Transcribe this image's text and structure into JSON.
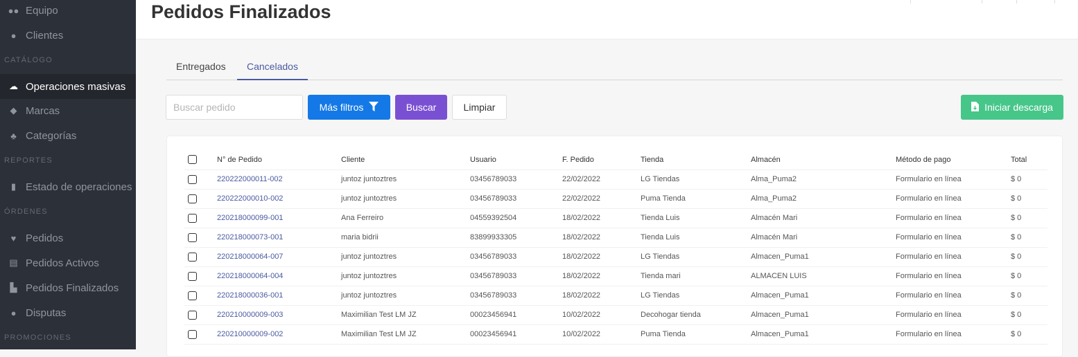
{
  "sidebar": {
    "items": [
      {
        "label": "Equipo",
        "icon": "users-icon"
      },
      {
        "label": "Clientes",
        "icon": "user-icon"
      },
      {
        "label": "Operaciones masivas",
        "icon": "cloud-upload-icon"
      },
      {
        "label": "Marcas",
        "icon": "tags-icon"
      },
      {
        "label": "Categorías",
        "icon": "sitemap-icon"
      },
      {
        "label": "Estado de operaciones",
        "icon": "file-upload-icon"
      },
      {
        "label": "Pedidos",
        "icon": "parachute-box-icon"
      },
      {
        "label": "Pedidos Activos",
        "icon": "file-alt-icon"
      },
      {
        "label": "Pedidos Finalizados",
        "icon": "pallet-icon"
      },
      {
        "label": "Disputas",
        "icon": "comments-icon"
      }
    ],
    "sections": [
      "CATÁLOGO",
      "REPORTES",
      "ÓRDENES",
      "PROMOCIONES"
    ]
  },
  "header": {
    "title": "Pedidos Finalizados"
  },
  "tabs": [
    "Entregados",
    "Cancelados"
  ],
  "toolbar": {
    "search_placeholder": "Buscar pedido",
    "more_filters": "Más filtros",
    "search": "Buscar",
    "clear": "Limpiar",
    "download": "Iniciar descarga"
  },
  "table": {
    "columns": [
      "N° de Pedido",
      "Cliente",
      "Usuario",
      "F. Pedido",
      "Tienda",
      "Almacén",
      "Método de pago",
      "Total"
    ],
    "rows": [
      [
        "220222000011-002",
        "juntoz juntoztres",
        "03456789033",
        "22/02/2022",
        "LG Tiendas",
        "Alma_Puma2",
        "Formulario en línea",
        "$ 0"
      ],
      [
        "220222000010-002",
        "juntoz juntoztres",
        "03456789033",
        "22/02/2022",
        "Puma Tienda",
        "Alma_Puma2",
        "Formulario en línea",
        "$ 0"
      ],
      [
        "220218000099-001",
        "Ana Ferreiro",
        "04559392504",
        "18/02/2022",
        "Tienda Luis",
        "Almacén Mari",
        "Formulario en línea",
        "$ 0"
      ],
      [
        "220218000073-001",
        "maria bidrii",
        "83899933305",
        "18/02/2022",
        "Tienda Luis",
        "Almacén Mari",
        "Formulario en línea",
        "$ 0"
      ],
      [
        "220218000064-007",
        "juntoz juntoztres",
        "03456789033",
        "18/02/2022",
        "LG Tiendas",
        "Almacen_Puma1",
        "Formulario en línea",
        "$ 0"
      ],
      [
        "220218000064-004",
        "juntoz juntoztres",
        "03456789033",
        "18/02/2022",
        "Tienda mari",
        "ALMACEN LUIS",
        "Formulario en línea",
        "$ 0"
      ],
      [
        "220218000036-001",
        "juntoz juntoztres",
        "03456789033",
        "18/02/2022",
        "LG Tiendas",
        "Almacen_Puma1",
        "Formulario en línea",
        "$ 0"
      ],
      [
        "220210000009-003",
        "Maximilian Test LM JZ",
        "00023456941",
        "10/02/2022",
        "Decohogar tienda",
        "Almacen_Puma1",
        "Formulario en línea",
        "$ 0"
      ],
      [
        "220210000009-002",
        "Maximilian Test LM JZ",
        "00023456941",
        "10/02/2022",
        "Puma Tienda",
        "Almacen_Puma1",
        "Formulario en línea",
        "$ 0"
      ]
    ]
  }
}
